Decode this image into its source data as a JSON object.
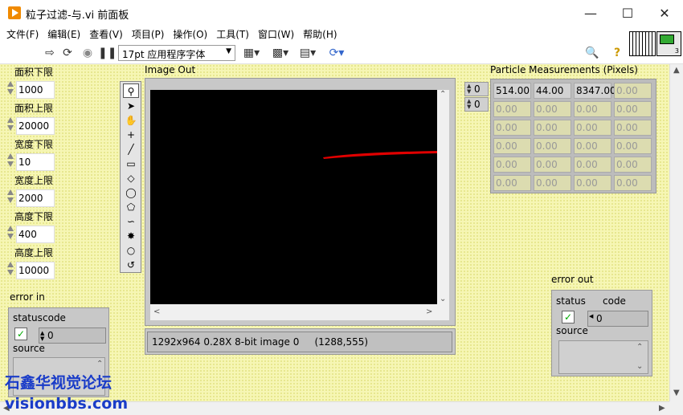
{
  "window": {
    "title": "粒子过滤-与.vi 前面板"
  },
  "menu": [
    "文件(F)",
    "编辑(E)",
    "查看(V)",
    "项目(P)",
    "操作(O)",
    "工具(T)",
    "窗口(W)",
    "帮助(H)"
  ],
  "toolbar": {
    "font_select": "17pt 应用程序字体",
    "vi_icon_number": "3"
  },
  "controls": [
    {
      "label": "面积下限",
      "value": "1000"
    },
    {
      "label": "面积上限",
      "value": "20000"
    },
    {
      "label": "宽度下限",
      "value": "10"
    },
    {
      "label": "宽度上限",
      "value": "2000"
    },
    {
      "label": "高度下限",
      "value": "400"
    },
    {
      "label": "高度上限",
      "value": "10000"
    }
  ],
  "image_out": {
    "label": "Image Out",
    "status": "1292x964 0.28X 8-bit image 0     (1288,555)"
  },
  "particle_measurements": {
    "label": "Particle Measurements (Pixels)",
    "index_row": "0",
    "index_col": "0",
    "rows": [
      [
        "514.00",
        "44.00",
        "8347.00",
        "0.00"
      ],
      [
        "0.00",
        "0.00",
        "0.00",
        "0.00"
      ],
      [
        "0.00",
        "0.00",
        "0.00",
        "0.00"
      ],
      [
        "0.00",
        "0.00",
        "0.00",
        "0.00"
      ],
      [
        "0.00",
        "0.00",
        "0.00",
        "0.00"
      ],
      [
        "0.00",
        "0.00",
        "0.00",
        "0.00"
      ]
    ]
  },
  "error_in": {
    "label": "error in",
    "status_label": "status",
    "code_label": "code",
    "code_value": "0",
    "source_label": "source"
  },
  "error_out": {
    "label": "error out",
    "status_label": "status",
    "code_label": "code",
    "code_value": "0",
    "source_label": "source"
  },
  "watermark": {
    "line1": "石鑫华视觉论坛",
    "line2": "visionbbs.com"
  }
}
